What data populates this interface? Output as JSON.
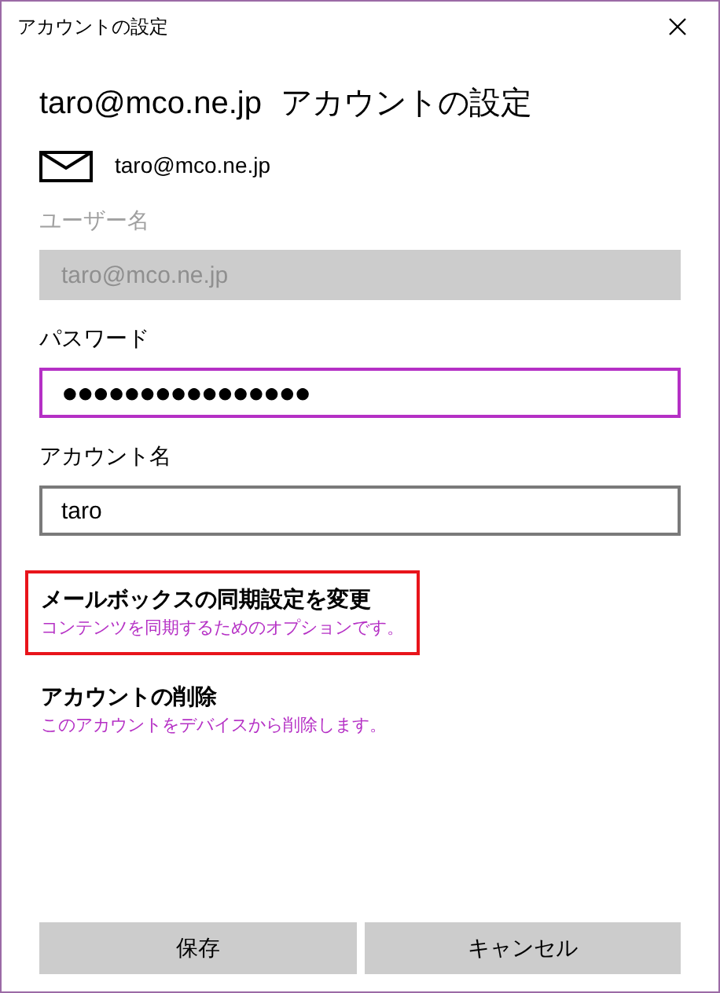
{
  "window": {
    "title": "アカウントの設定"
  },
  "heading": {
    "email": "taro@mco.ne.jp",
    "title": "アカウントの設定"
  },
  "account_email": "taro@mco.ne.jp",
  "fields": [
    {
      "label": "ユーザー名",
      "value": "taro@mco.ne.jp",
      "disabled": true,
      "focused": false
    },
    {
      "label": "パスワード",
      "value": "●●●●●●●●●●●●●●●●",
      "disabled": false,
      "focused": true
    },
    {
      "label": "アカウント名",
      "value": "taro",
      "disabled": false,
      "focused": false
    }
  ],
  "links": [
    {
      "title": "メールボックスの同期設定を変更",
      "description": "コンテンツを同期するためのオプションです。",
      "highlighted": true
    },
    {
      "title": "アカウントの削除",
      "description": "このアカウントをデバイスから削除します。",
      "highlighted": false
    }
  ],
  "buttons": [
    "保存",
    "キャンセル"
  ]
}
